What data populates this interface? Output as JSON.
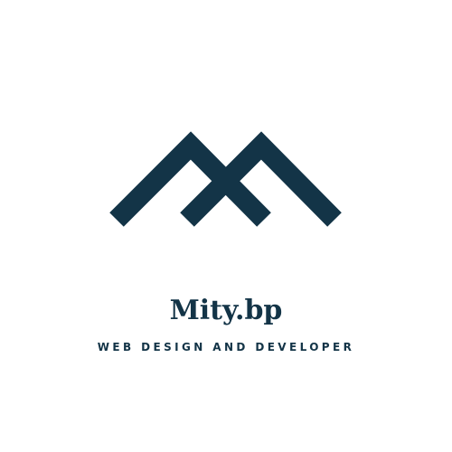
{
  "brand": {
    "name": "Mity.bp",
    "tagline": "WEB DESIGN AND DEVELOPER"
  },
  "colors": {
    "background": "#ffffff",
    "primary": "#133447"
  },
  "icons": {
    "logo": "mountain-m-logo-icon"
  }
}
